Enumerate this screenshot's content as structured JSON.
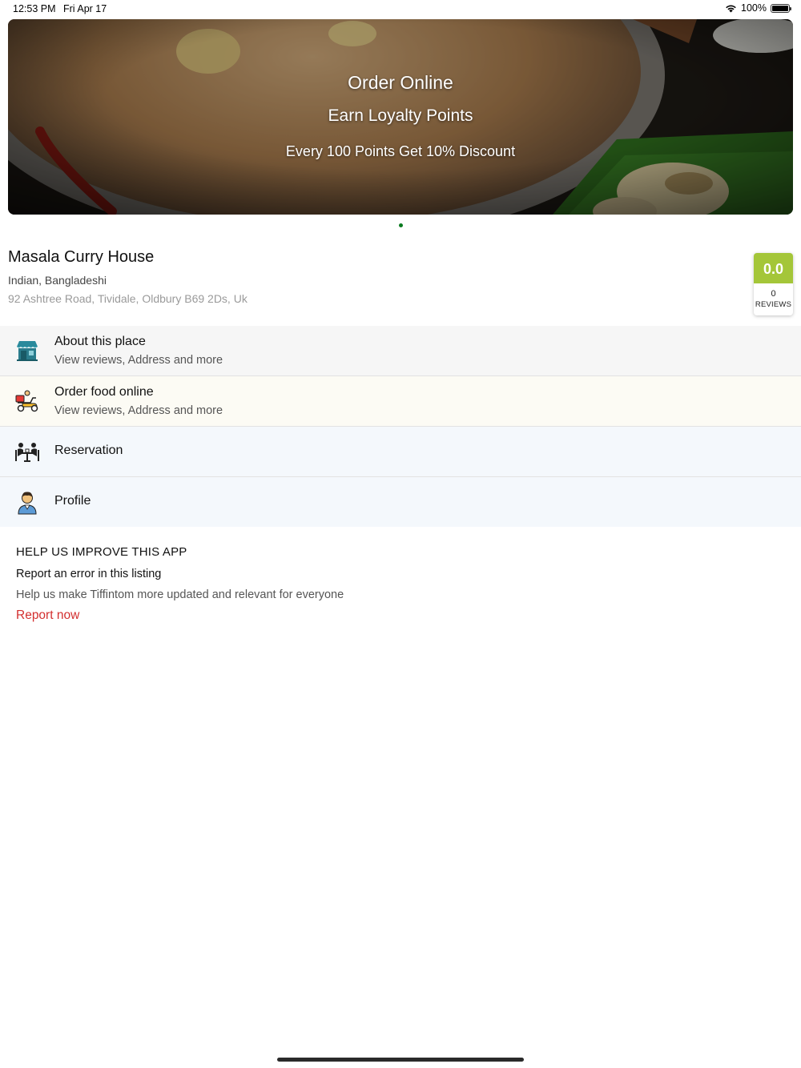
{
  "status_bar": {
    "time": "12:53 PM",
    "date": "Fri Apr 17",
    "battery": "100%",
    "battery_level": 1.0
  },
  "banner": {
    "line1": "Order Online",
    "line2": "Earn Loyalty Points",
    "line3": "Every 100 Points Get 10% Discount",
    "page_count": 1,
    "active_page": 1
  },
  "restaurant": {
    "name": "Masala Curry House",
    "cuisine": "Indian, Bangladeshi",
    "address": "92 Ashtree Road, Tividale, Oldbury B69 2Ds, Uk",
    "rating": "0.0",
    "review_count": "0",
    "reviews_label": "REVIEWS",
    "rating_color": "#a4c639"
  },
  "menu": {
    "items": [
      {
        "title": "About this place",
        "subtitle": "View reviews, Address and more",
        "icon": "storefront-icon"
      },
      {
        "title": "Order food online",
        "subtitle": "View reviews, Address and more",
        "icon": "delivery-scooter-icon"
      },
      {
        "title": "Reservation",
        "icon": "dining-table-icon"
      },
      {
        "title": "Profile",
        "icon": "user-profile-icon"
      }
    ]
  },
  "help": {
    "heading": "HELP US IMPROVE THIS APP",
    "title": "Report an error in this listing",
    "description": "Help us make Tiffintom more updated and relevant for everyone",
    "link": "Report now",
    "link_color": "#d32f2f"
  }
}
